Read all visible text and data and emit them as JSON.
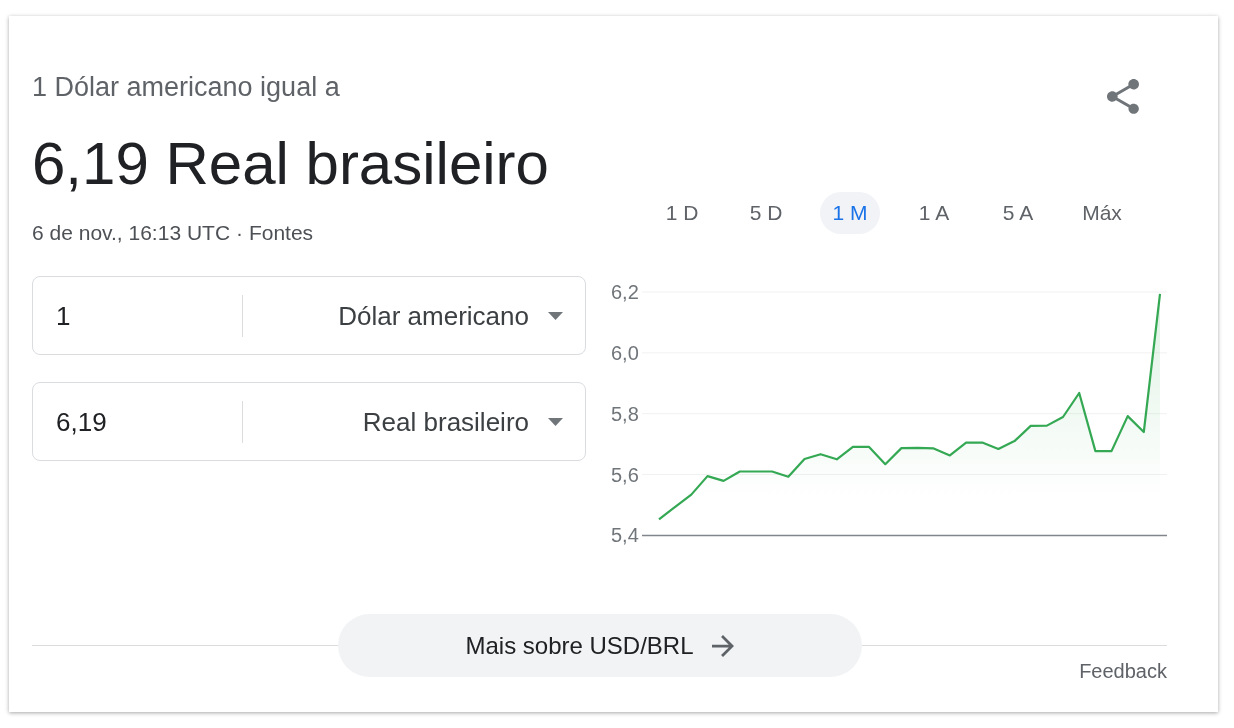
{
  "header": {
    "subtitle": "1 Dólar americano igual a",
    "result": "6,19 Real brasileiro",
    "timestamp": "6 de nov., 16:13 UTC ·",
    "source_link": "Fontes"
  },
  "ranges": [
    {
      "label": "1 D",
      "selected": false
    },
    {
      "label": "5 D",
      "selected": false
    },
    {
      "label": "1 M",
      "selected": true
    },
    {
      "label": "1 A",
      "selected": false
    },
    {
      "label": "5 A",
      "selected": false
    },
    {
      "label": "Máx",
      "selected": false
    }
  ],
  "converter": [
    {
      "value": "1",
      "currency": "Dólar americano"
    },
    {
      "value": "6,19",
      "currency": "Real brasileiro"
    }
  ],
  "chart": {
    "chart_data": {
      "type": "area",
      "grid": true,
      "ylim": [
        5.4,
        6.2
      ],
      "yticks": [
        {
          "value": 5.4,
          "label": "5,4"
        },
        {
          "value": 5.6,
          "label": "5,6"
        },
        {
          "value": 5.8,
          "label": "5,8"
        },
        {
          "value": 6.0,
          "label": "6,0"
        },
        {
          "value": 6.2,
          "label": "6,2"
        }
      ],
      "series": [
        {
          "color": "#34a853",
          "values": [
            5.453,
            5.494,
            5.534,
            5.595,
            5.579,
            5.61,
            5.61,
            5.61,
            5.593,
            5.651,
            5.667,
            5.65,
            5.691,
            5.691,
            5.634,
            5.687,
            5.688,
            5.686,
            5.663,
            5.705,
            5.705,
            5.684,
            5.71,
            5.76,
            5.761,
            5.789,
            5.868,
            5.677,
            5.677,
            5.792,
            5.74,
            6.194
          ]
        }
      ]
    }
  },
  "more_button": "Mais sobre USD/BRL",
  "feedback_link": "Feedback"
}
